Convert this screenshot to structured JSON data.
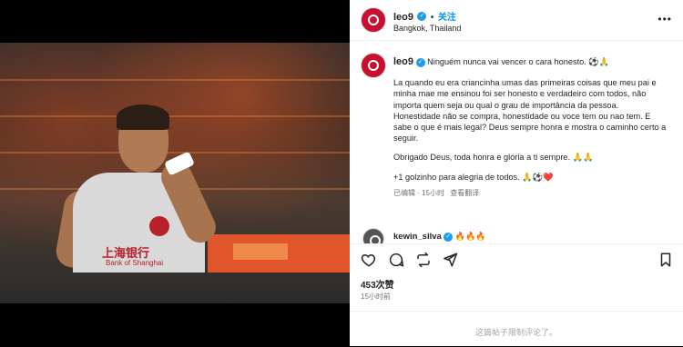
{
  "post": {
    "sponsor_text": "上海银行",
    "sponsor_sub": "Bank of Shanghai"
  },
  "header": {
    "username": "leo9",
    "follow_label": "关注",
    "location": "Bangkok, Thailand",
    "more_label": "•••"
  },
  "caption": {
    "username": "leo9",
    "first_line": "Ninguém nunca vai vencer o cara honesto. ⚽🙏",
    "paragraph1": "La quando eu era criancinha umas das primeiras coisas que meu pai e minha mae me ensinou foi ser honesto e verdadeiro com todos, não importa quem seja ou qual o grau de importância da pessoa. Honestidade não se compra, honestidade ou voce tem ou nao tem. E sabe o que é mais legal? Deus sempre honra e mostra o caminho certo a seguir.",
    "paragraph2": "Obrigado Deus, toda honra e glória a ti sempre. 🙏🙏",
    "paragraph3": "+1 golzinho para alegria de todos. 🙏⚽❤️",
    "edited_label": "已编辑 · 15小时",
    "translate_label": "查看翻译"
  },
  "comment": {
    "username": "kewin_silva",
    "text": "🔥🔥🔥"
  },
  "stats": {
    "likes": "453次赞",
    "time_ago": "15小时前"
  },
  "footer": {
    "restricted_text": "这篇帖子限制评论了。"
  },
  "colors": {
    "accent": "#0095f6",
    "verified": "#1d9bf0",
    "avatar": "#c8102e"
  }
}
